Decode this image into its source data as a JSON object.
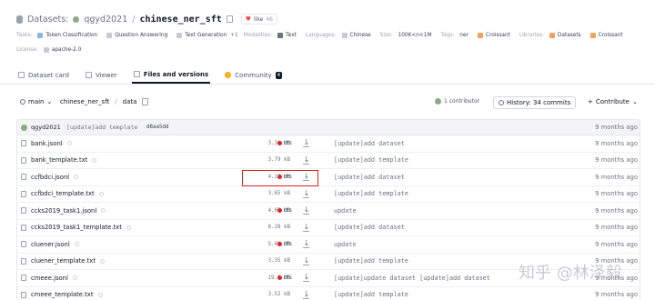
{
  "header": {
    "crumb": "Datasets:",
    "owner": "qgyd2021",
    "separator": "/",
    "repo": "chinese_ner_sft",
    "like_label": "like",
    "like_count": "46"
  },
  "tags_row": {
    "tasks_key": "Tasks:",
    "tasks": [
      "Token Classification",
      "Question Answering",
      "Text Generation"
    ],
    "tasks_more": "+1",
    "modalities_key": "Modalities:",
    "modalities": [
      "Text"
    ],
    "languages_key": "Languages:",
    "languages": [
      "Chinese"
    ],
    "size_key": "Size:",
    "size": "100K<n<1M",
    "tags_key": "Tags:",
    "tags": [
      "ner"
    ],
    "croissant": "Croissant",
    "libraries_key": "Libraries:",
    "libraries": [
      "Datasets",
      "Croissant"
    ]
  },
  "license_row": {
    "key": "License:",
    "value": "apache-2.0"
  },
  "tabs": [
    {
      "label": "Dataset card",
      "active": false
    },
    {
      "label": "Viewer",
      "active": false
    },
    {
      "label": "Files and versions",
      "active": true
    },
    {
      "label": "Community",
      "active": false,
      "badge": "4"
    }
  ],
  "toolbar": {
    "branch": "main",
    "path_repo": "chinese_ner_sft",
    "path_dir": "data",
    "contributors": "1 contributor",
    "history": "History: 34 commits",
    "contribute": "Contribute"
  },
  "last_commit": {
    "user": "qgyd2021",
    "message": "[update]add template",
    "hash": "d8aa5dd",
    "date": "9 months ago"
  },
  "files": [
    {
      "name": "bank.jsonl",
      "size": "3.31 MB",
      "lfs": true,
      "message": "[update]add dataset",
      "date": "9 months ago"
    },
    {
      "name": "bank_template.txt",
      "size": "3.79 kB",
      "lfs": false,
      "message": "[update]add template",
      "date": "9 months ago"
    },
    {
      "name": "ccfbdci.jsonl",
      "size": "4.16 MB",
      "lfs": true,
      "message": "[update]add dataset",
      "date": "9 months ago"
    },
    {
      "name": "ccfbdci_template.txt",
      "size": "3.65 kB",
      "lfs": false,
      "message": "[update]add template",
      "date": "9 months ago"
    },
    {
      "name": "ccks2019_task1.jsonl",
      "size": "4.07 MB",
      "lfs": true,
      "message": "update",
      "date": "9 months ago"
    },
    {
      "name": "ccks2019_task1_template.txt",
      "size": "6.28 kB",
      "lfs": false,
      "message": "[update]add dataset",
      "date": "9 months ago"
    },
    {
      "name": "cluener.jsonl",
      "size": "5.49 MB",
      "lfs": true,
      "message": "update",
      "date": "9 months ago"
    },
    {
      "name": "cluener_template.txt",
      "size": "3.35 kB",
      "lfs": false,
      "message": "[update]add template",
      "date": "9 months ago"
    },
    {
      "name": "cmeee.jsonl",
      "size": "19.9 MB",
      "lfs": true,
      "message": "[update]update dataset [update]add dataset",
      "date": "9 months ago"
    },
    {
      "name": "cmeee_template.txt",
      "size": "3.52 kB",
      "lfs": false,
      "message": "[update]add template",
      "date": "9 months ago"
    }
  ],
  "lfs_label": "LFS",
  "watermark": "知乎 @林泽毅",
  "colors": {
    "highlight_box": "#d92027",
    "lfs_red": "#dc2626",
    "active_tab": "#111827"
  }
}
